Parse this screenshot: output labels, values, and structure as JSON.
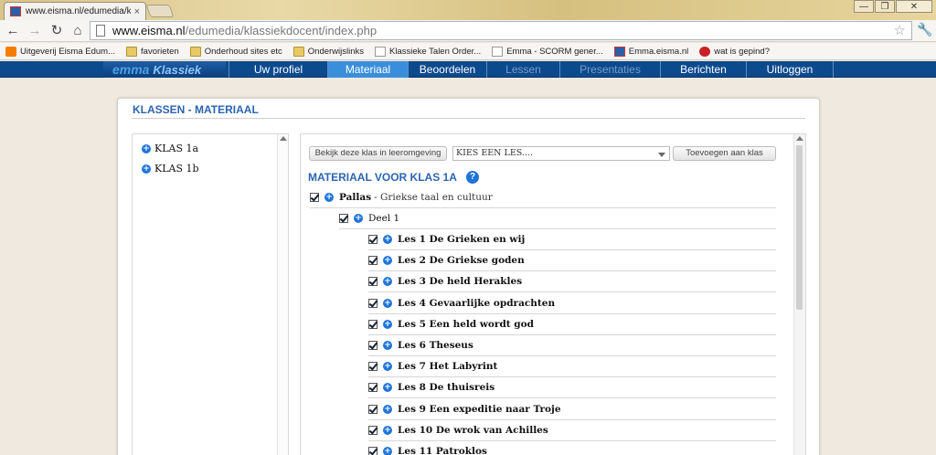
{
  "browser": {
    "tab_title": "www.eisma.nl/edumedia/klas",
    "tab_close": "×",
    "window_buttons": [
      "—",
      "❐",
      "✕"
    ],
    "nav": {
      "back": "←",
      "forward": "→",
      "reload": "↻",
      "home": "⌂"
    },
    "address_host": "www.eisma.nl",
    "address_path": "/edumedia/klassiekdocent/index.php",
    "star": "☆",
    "wrench": "🔧",
    "bookmarks": [
      {
        "label": "Uitgeverij Eisma Edum...",
        "icon": "blogger-icon"
      },
      {
        "label": "favorieten",
        "icon": "folder-icon"
      },
      {
        "label": "Onderhoud sites etc",
        "icon": "folder-icon"
      },
      {
        "label": "Onderwijslinks",
        "icon": "folder-icon"
      },
      {
        "label": "Klassieke Talen Order...",
        "icon": "page-icon"
      },
      {
        "label": "Emma - SCORM gener...",
        "icon": "page-icon"
      },
      {
        "label": "Emma.eisma.nl",
        "icon": "emma-icon"
      },
      {
        "label": "wat is gepind?",
        "icon": "pinterest-icon"
      }
    ]
  },
  "site": {
    "logo_main": "emma",
    "logo_sub": "Klassiek",
    "nav": [
      {
        "label": "Uw profiel",
        "state": "normal"
      },
      {
        "label": "Materiaal",
        "state": "active"
      },
      {
        "label": "Beoordelen",
        "state": "normal"
      },
      {
        "label": "Lessen",
        "state": "disabled"
      },
      {
        "label": "Presentaties",
        "state": "disabled"
      },
      {
        "label": "Berichten",
        "state": "normal"
      },
      {
        "label": "Uitloggen",
        "state": "normal"
      }
    ]
  },
  "panel": {
    "title": "KLASSEN - MATERIAAL",
    "classes": [
      "KLAS 1a",
      "KLAS 1b"
    ],
    "view_button": "Bekijk deze klas in leeromgeving",
    "lesson_select": "KIES EEN LES....",
    "add_button": "Toevoegen aan klas",
    "material_title": "MATERIAAL VOOR KLAS 1A",
    "help": "?",
    "book": {
      "name": "Pallas",
      "subtitle": "- Griekse taal en cultuur"
    },
    "part": "Deel 1",
    "lessons": [
      "Les 1 De Grieken en wij",
      "Les 2 De Griekse goden",
      "Les 3 De held Herakles",
      "Les 4 Gevaarlijke opdrachten",
      "Les 5 Een held wordt god",
      "Les 6 Theseus",
      "Les 7 Het Labyrint",
      "Les 8 De thuisreis",
      "Les 9 Een expeditie naar Troje",
      "Les 10 De wrok van Achilles",
      "Les 11 Patroklos"
    ]
  },
  "colors": {
    "nav_bg": "#0c4a8e",
    "nav_active": "#3a8fdc",
    "accent_title": "#2c64b0"
  }
}
